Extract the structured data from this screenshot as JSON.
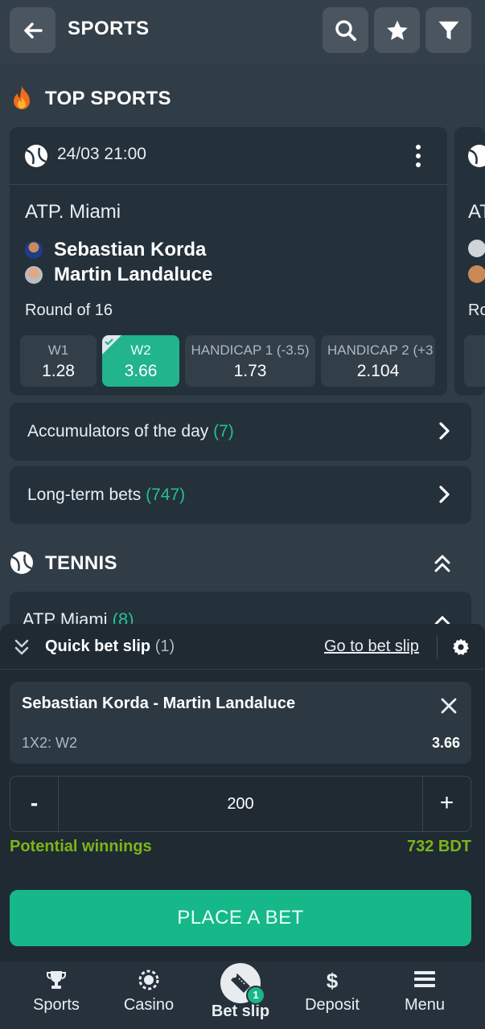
{
  "header": {
    "title": "SPORTS",
    "back_icon": "arrow-left-icon",
    "search_icon": "search-icon",
    "favorites_icon": "star-icon",
    "filter_icon": "filter-icon"
  },
  "top_sports": {
    "title": "TOP SPORTS",
    "icon": "fire-icon",
    "event": {
      "datetime": "24/03 21:00",
      "league": "ATP. Miami",
      "team1": "Sebastian Korda",
      "team2": "Martin Landaluce",
      "round": "Round of 16",
      "odds": [
        {
          "label": "W1",
          "value": "1.28",
          "selected": false
        },
        {
          "label": "W2",
          "value": "3.66",
          "selected": true
        },
        {
          "label": "HANDICAP 1 (-3.5)",
          "value": "1.73",
          "selected": false
        },
        {
          "label": "HANDICAP 2 (+3",
          "value": "2.104",
          "selected": false
        }
      ]
    },
    "peek": {
      "league": "AT",
      "round": "Ro"
    }
  },
  "links": {
    "accumulators": {
      "label": "Accumulators of the day",
      "count": "(7)"
    },
    "long_term": {
      "label": "Long-term bets",
      "count": "(747)"
    }
  },
  "tennis": {
    "title": "TENNIS",
    "subgroup": {
      "label": "ATP Miami",
      "count": "(8)"
    }
  },
  "quick_bet_slip": {
    "title": "Quick bet slip",
    "count": "(1)",
    "go_to_label": "Go to bet slip",
    "bet": {
      "match": "Sebastian Korda - Martin Landaluce",
      "market": "1X2: W2",
      "odd": "3.66"
    },
    "stake": {
      "minus": "-",
      "amount": "200",
      "plus": "+"
    },
    "potential_label": "Potential winnings",
    "potential_value": "732 BDT",
    "place_label": "PLACE A BET"
  },
  "bottom_nav": {
    "items": [
      {
        "label": "Sports",
        "icon": "trophy-icon"
      },
      {
        "label": "Casino",
        "icon": "casino-chip-icon"
      },
      {
        "label": "Bet slip",
        "icon": "ticket-icon",
        "badge": "1"
      },
      {
        "label": "Deposit",
        "icon": "dollar-icon"
      },
      {
        "label": "Menu",
        "icon": "menu-icon"
      }
    ]
  },
  "colors": {
    "accent": "#16b88a",
    "background": "#303c46",
    "card": "#24303a",
    "winnings": "#7cb518"
  }
}
